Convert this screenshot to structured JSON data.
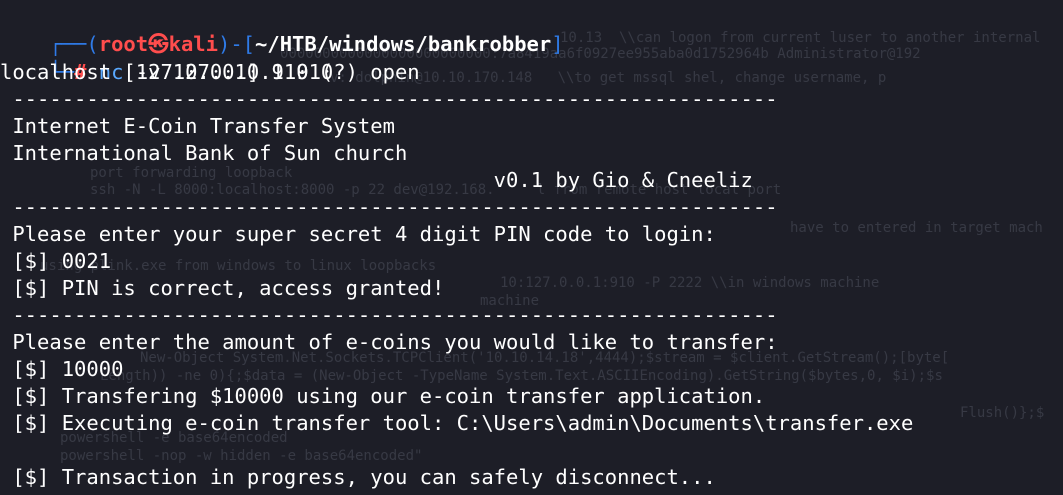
{
  "prompt": {
    "frame_top_open": "┌──(",
    "user": "root",
    "skull": "㉿",
    "host": "kali",
    "frame_mid": ")-[",
    "cwd": "~/HTB/windows/bankrobber",
    "frame_end": "]",
    "frame_bottom": "└─",
    "hash": "#",
    "command": "nc",
    "args": " -v 127.0.0.1 910"
  },
  "output": [
    "localhost [127.0.0.1] 910 (?) open",
    " --------------------------------------------------------------",
    " Internet E-Coin Transfer System",
    " International Bank of Sun church",
    "                                        v0.1 by Gio & Cneeliz",
    " --------------------------------------------------------------",
    " Please enter your super secret 4 digit PIN code to login:",
    " [$] 0021",
    " [$] PIN is correct, access granted!",
    " --------------------------------------------------------------",
    " Please enter the amount of e-coins you would like to transfer:",
    " [$] 10000",
    " [$] Transfering $10000 using our e-coin transfer application.",
    " [$] Executing e-coin transfer tool: C:\\Users\\admin\\Documents\\transfer.exe",
    "",
    " [$] Transaction in progress, you can safely disconnect..."
  ]
}
